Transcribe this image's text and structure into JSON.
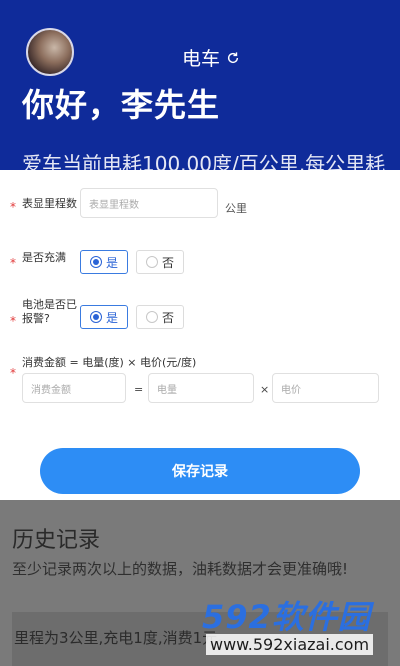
{
  "header": {
    "mode_label": "电车",
    "greeting": "你好，李先生",
    "consumption_text": "爱车当前电耗100.00度/百公里,每公里耗"
  },
  "form": {
    "odometer": {
      "label": "表显里程数",
      "placeholder": "表显里程数",
      "unit": "公里"
    },
    "full_charge": {
      "label": "是否充满",
      "options": [
        "是",
        "否"
      ],
      "selected": "是"
    },
    "battery_alarm": {
      "label": "电池是否已\n报警?",
      "options": [
        "是",
        "否"
      ],
      "selected": "是"
    },
    "cost": {
      "formula": "消费金额 = 电量(度) × 电价(元/度)",
      "amount_placeholder": "消费金额",
      "equals": "=",
      "quantity_placeholder": "电量",
      "times": "×",
      "price_placeholder": "电价"
    },
    "save_label": "保存记录"
  },
  "history": {
    "title": "历史记录",
    "note": "至少记录两次以上的数据，油耗数据才会更准确哦!",
    "record_text": "里程为3公里,充电1度,消费1元。"
  },
  "watermark": {
    "logo_text": "592软件园",
    "url": "www.592xiazai.com"
  },
  "colors": {
    "header_bg": "#0f2b9a",
    "accent": "#2d8df5",
    "required": "#e23b3b"
  }
}
